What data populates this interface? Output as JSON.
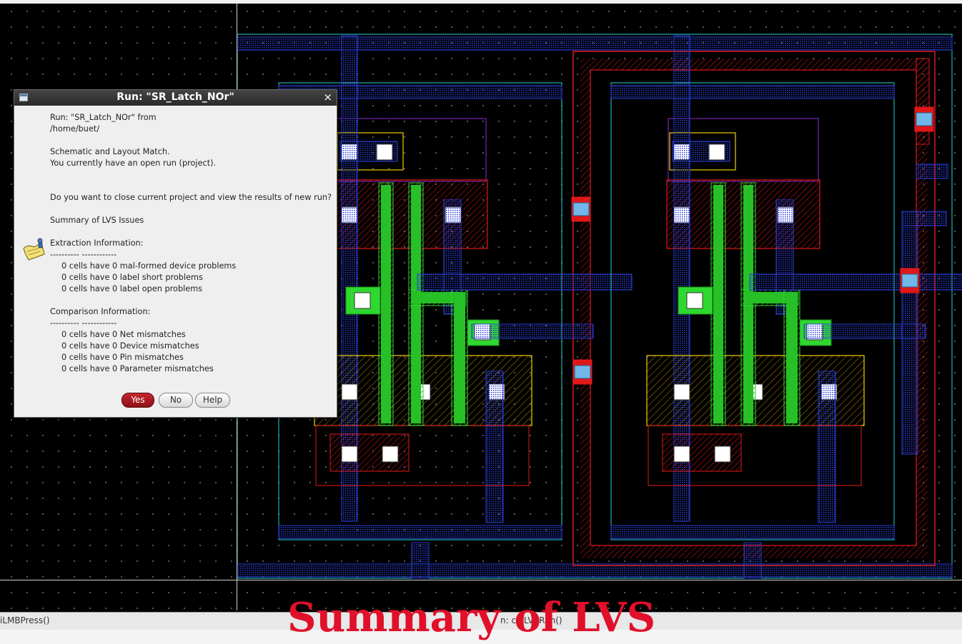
{
  "dialog": {
    "title": "Run: \"SR_Latch_NOr\"",
    "lines": [
      "Run: \"SR_Latch_NOr\" from",
      "/home/buet/",
      "",
      "Schematic and Layout Match.",
      "You currently have an open run (project).",
      "",
      "",
      "Do you want to close current project and view the results of new run?",
      "",
      "Summary of LVS Issues",
      "",
      "Extraction Information:",
      "---------- ------------",
      "0 cells have 0 mal-formed device problems",
      "0 cells have 0 label short problems",
      "0 cells have 0 label open problems",
      "",
      "Comparison Information:",
      "---------- ------------",
      "0 cells have 0 Net mismatches",
      "0 cells have 0 Device mismatches",
      "0 cells have 0 Pin mismatches",
      "0 cells have 0 Parameter mismatches"
    ],
    "buttons": {
      "yes": "Yes",
      "no": "No",
      "help": "Help"
    },
    "close_glyph": "×",
    "icon": "note-icon"
  },
  "status_bar": {
    "left_text": "iLMBPress()",
    "right_text": "n: cuiLVSRun()"
  },
  "overlay_title": "Summary of LVS",
  "colors": {
    "canvas_bg": "#000000",
    "metal1": "#2b3fd8",
    "poly": "#2fd82f",
    "nwell": "#e01818",
    "active": "#f0d000",
    "cyan_boundary": "#1fd6d6",
    "contact": "#ffffff",
    "via": "#6fb8e8",
    "overlay_title": "#e0102a",
    "yes_button": "#b0181f"
  }
}
